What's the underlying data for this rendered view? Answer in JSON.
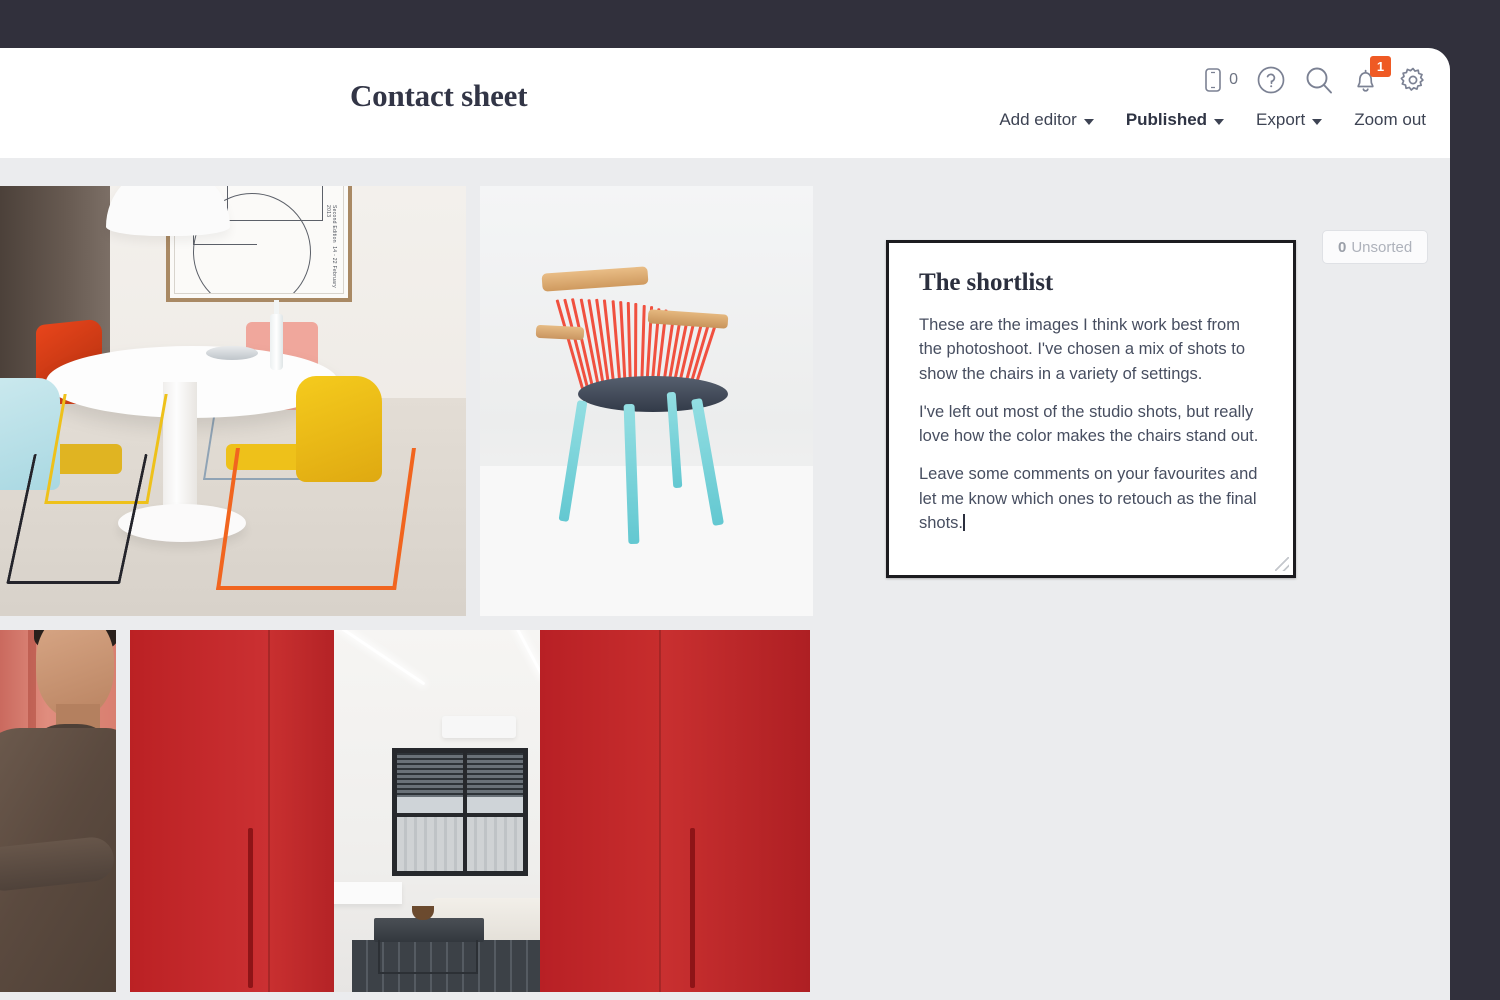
{
  "header": {
    "title": "Contact sheet",
    "icons": [
      {
        "name": "mobile-preview-icon",
        "label": "0"
      },
      {
        "name": "help-icon",
        "label": "?"
      },
      {
        "name": "search-icon",
        "label": ""
      },
      {
        "name": "notifications-icon",
        "label": "",
        "badge": "1"
      },
      {
        "name": "settings-gear-icon",
        "label": ""
      }
    ],
    "toolbar": [
      {
        "label": "Add editor",
        "has_caret": true,
        "active": false
      },
      {
        "label": "Published",
        "has_caret": true,
        "active": true
      },
      {
        "label": "Export",
        "has_caret": true,
        "active": false
      },
      {
        "label": "Zoom out",
        "has_caret": false,
        "active": false
      }
    ]
  },
  "content": {
    "unsorted": {
      "count": "0",
      "label": "Unsorted"
    },
    "photos": [
      {
        "name": "photo-dining-room",
        "alt": "Dining room with white round table and colorful chairs"
      },
      {
        "name": "photo-studio-chair",
        "alt": "Studio shot of red spindle chair with teal legs"
      },
      {
        "name": "photo-model-portrait",
        "alt": "Man in brown turtleneck against coral wall"
      },
      {
        "name": "photo-red-wardrobe",
        "alt": "Red wardrobe doors opening onto white living room"
      }
    ]
  },
  "shortlist": {
    "title": "The shortlist",
    "paragraphs": [
      "These are the images I think work best from the photoshoot. I've chosen a mix of shots to show the chairs in a variety of settings.",
      "I've left out most of the studio shots, but really love how the color makes the chairs stand out.",
      "Leave some comments on your favourites and let me know which ones to retouch as the final shots."
    ]
  },
  "colors": {
    "chrome_dark": "#31303c",
    "canvas": "#ebecee",
    "accent_orange": "#ef5a24",
    "text_dark": "#2b2f3e",
    "text_body": "#474e60"
  }
}
